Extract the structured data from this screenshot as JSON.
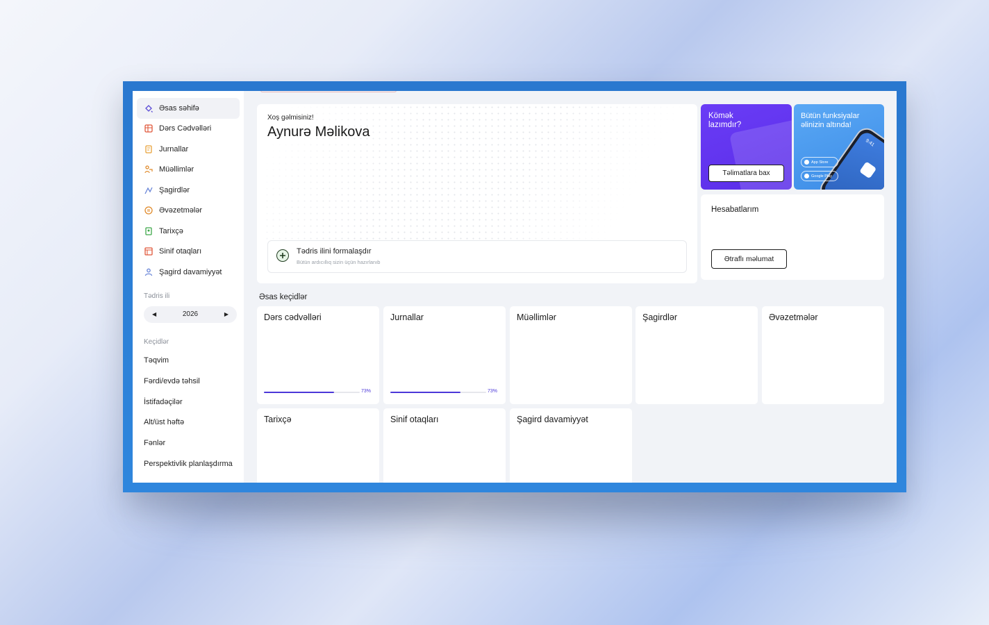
{
  "sidebar": {
    "nav": [
      {
        "label": "Əsas səhifə",
        "icon": "sparkle-icon",
        "color": "#5b4bd6",
        "active": true
      },
      {
        "label": "Dərs Cədvəlləri",
        "icon": "table-icon",
        "color": "#e0573a"
      },
      {
        "label": "Jurnallar",
        "icon": "journal-icon",
        "color": "#e8a23a"
      },
      {
        "label": "Müəllimlər",
        "icon": "teacher-icon",
        "color": "#e08a2a"
      },
      {
        "label": "Şagirdlər",
        "icon": "students-icon",
        "color": "#6a86d8"
      },
      {
        "label": "Əvəzetmələr",
        "icon": "swap-icon",
        "color": "#e08a2a"
      },
      {
        "label": "Tarixçə",
        "icon": "history-icon",
        "color": "#3fa84a"
      },
      {
        "label": "Sinif otaqları",
        "icon": "classroom-icon",
        "color": "#e0573a"
      },
      {
        "label": "Şagird davamiyyət",
        "icon": "attendance-icon",
        "color": "#6a86d8"
      }
    ],
    "year_label": "Tədris ili",
    "year_value": "2026",
    "links_label": "Keçidlər",
    "links": [
      "Təqvim",
      "Fərdi/evdə təhsil",
      "İstifadəçilər",
      "Alt/üst həftə",
      "Fənlər",
      "Perspektivlik planlaşdırma"
    ]
  },
  "welcome": {
    "greeting": "Xoş gəlmisiniz!",
    "name": "Aynurə Məlikova",
    "form_title": "Tədris ilini formalaşdır",
    "form_subtitle": "Bütün ardıcıllıq sizin üçün hazırlanıb"
  },
  "help_card": {
    "title": "Kömək lazımdır?",
    "button": "Təlimatlara bax",
    "color": "#5b2ee8"
  },
  "app_card": {
    "title": "Bütün funksiyalar əlinizin altında!",
    "phone_time": "9:41",
    "app_store": "App Store",
    "google_play": "Google Play"
  },
  "reports_card": {
    "title": "Hesabatlarım",
    "button": "Ətraflı məlumat"
  },
  "quick_links": {
    "heading": "Əsas keçidlər",
    "tiles": [
      {
        "title": "Dərs cədvəlləri",
        "progress": 0.73,
        "progress_label": "73%"
      },
      {
        "title": "Jurnallar",
        "progress": 0.73,
        "progress_label": "73%"
      },
      {
        "title": "Müəllimlər"
      },
      {
        "title": "Şagirdlər"
      },
      {
        "title": "Əvəzetmələr"
      },
      {
        "title": "Tarixçə"
      },
      {
        "title": "Sinif otaqları"
      },
      {
        "title": "Şagird davamiyyət"
      }
    ],
    "accent": "#4b37d8"
  }
}
